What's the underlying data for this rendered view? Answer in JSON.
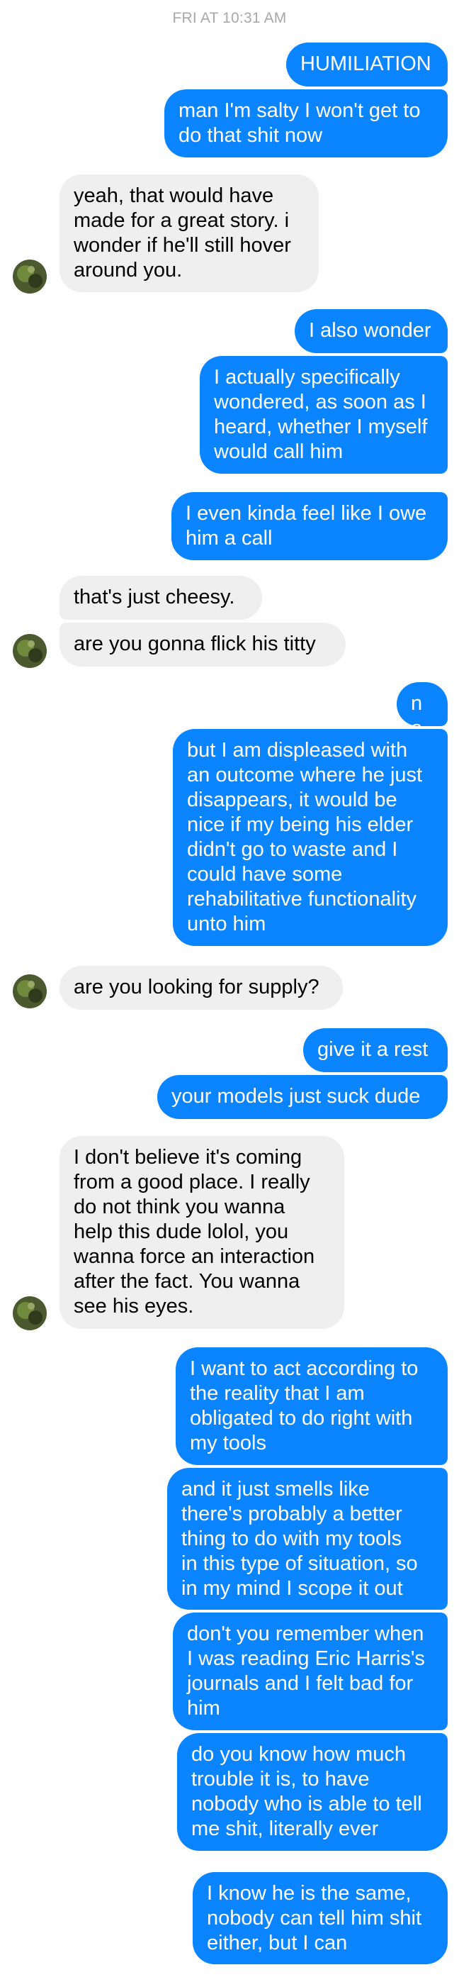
{
  "thread": {
    "timestamp": "FRI AT 10:31 AM",
    "messages": [
      {
        "sender": "me",
        "text": "HUMILIATION"
      },
      {
        "sender": "me",
        "text": "man I'm salty I won't get to\ndo that shit now"
      },
      {
        "sender": "them",
        "text": "yeah, that would have\nmade for a great story. i\nwonder if he'll still hover\naround you."
      },
      {
        "sender": "me",
        "text": "I also wonder"
      },
      {
        "sender": "me",
        "text": "I actually specifically\nwondered, as soon as I\nheard, whether I myself\nwould call him"
      },
      {
        "sender": "me",
        "text": "I even kinda feel like I owe\nhim a call"
      },
      {
        "sender": "them",
        "text": "that's just cheesy."
      },
      {
        "sender": "them",
        "text": "are you gonna flick his titty"
      },
      {
        "sender": "me",
        "text": "no,"
      },
      {
        "sender": "me",
        "text": "but I am displeased with\nan outcome where he just\ndisappears, it would be\nnice if my being his elder\ndidn't go to waste and I\ncould have some\nrehabilitative functionality\nunto him"
      },
      {
        "sender": "them",
        "text": "are you looking for supply?"
      },
      {
        "sender": "me",
        "text": "give it a rest"
      },
      {
        "sender": "me",
        "text": "your models just suck dude"
      },
      {
        "sender": "them",
        "text": "I don't believe it's coming\nfrom a good place. I really\ndo not think you wanna\nhelp this dude lolol, you\nwanna force an interaction\nafter the fact. You wanna\nsee his eyes."
      },
      {
        "sender": "me",
        "text": "I want to act according to\nthe reality that I am\nobligated to do right with\nmy tools"
      },
      {
        "sender": "me",
        "text": "and it just smells like\nthere's probably a better\nthing to do with my tools\nin this type of situation, so\nin my mind I scope it out"
      },
      {
        "sender": "me",
        "text": "don't you remember when\nI was reading Eric Harris's\njournals and I felt bad for\nhim"
      },
      {
        "sender": "me",
        "text": "do you know how much\ntrouble it is, to have\nnobody who is able to tell\nme shit, literally ever"
      },
      {
        "sender": "me",
        "text": "I know he is the same,\nnobody can tell him shit\neither, but I can"
      }
    ]
  },
  "colors": {
    "outgoing_bubble": "#0a84ff",
    "incoming_bubble": "#efefef",
    "timestamp_text": "#a7a7ac"
  },
  "icons": {
    "avatar": "contact-avatar-photo"
  }
}
